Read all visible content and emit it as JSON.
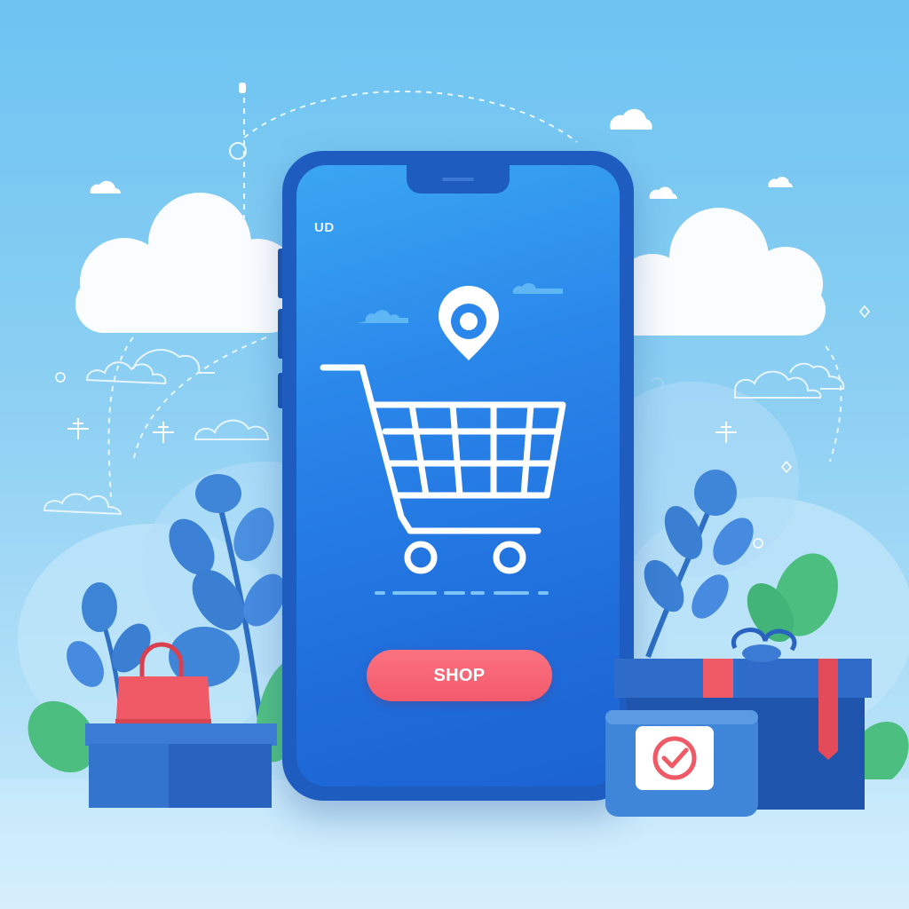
{
  "phone": {
    "brand_label": "UD",
    "shop_button_label": "SHOP"
  },
  "icons": [
    "cart-icon",
    "location-pin-icon",
    "shopping-bag-icon",
    "gift-box-icon",
    "checkmark-badge-icon",
    "cloud-icon",
    "leaf-icon"
  ],
  "colors": {
    "background": "#8ed0f3",
    "phone_frame": "#1e5cbf",
    "screen": "#2a86ea",
    "shop_button": "#f35a6c",
    "plant_blue": "#3f86d8",
    "plant_green": "#4cbf80",
    "box_blue": "#2f6cc9",
    "accent_red": "#ef5a66"
  }
}
